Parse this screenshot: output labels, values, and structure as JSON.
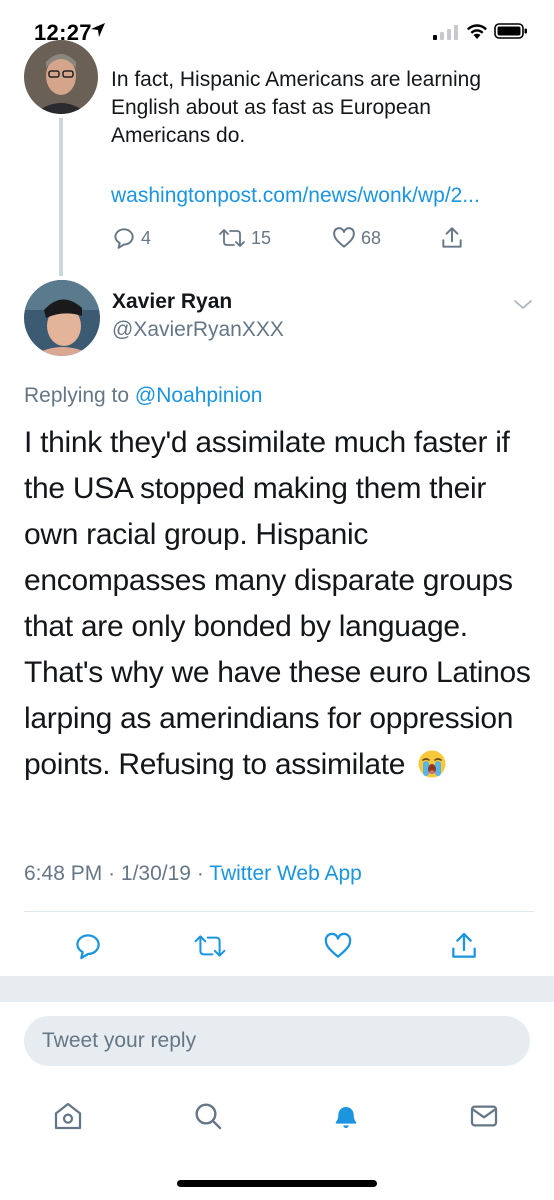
{
  "status_bar": {
    "time": "12:27",
    "icons": [
      "location-arrow-icon",
      "cellular-signal-icon",
      "wifi-icon",
      "battery-icon"
    ]
  },
  "previous_tweet": {
    "text": "In fact, Hispanic Americans are learning English about as fast as European Americans do.",
    "link": "washingtonpost.com/news/wonk/wp/2...",
    "reply_count": "4",
    "retweet_count": "15",
    "like_count": "68"
  },
  "tweet": {
    "author_name": "Xavier Ryan",
    "author_handle": "@XavierRyanXXX",
    "replying_to_label": "Replying to",
    "replying_to_handle": "@Noahpinion",
    "body": "I think they'd assimilate much faster if the USA stopped making them their own racial group. Hispanic encompasses many disparate groups that are only bonded by language. That's why we have these euro Latinos larping as amerindians for oppression points. Refusing to assimilate",
    "emoji": "loudly-crying-face-emoji",
    "time": "6:48 PM",
    "date": "1/30/19",
    "separator": "·",
    "source": "Twitter Web App"
  },
  "reply_input": {
    "placeholder": "Tweet your reply",
    "value": ""
  },
  "tab_bar": {
    "items": [
      "home-icon",
      "search-icon",
      "notifications-icon",
      "messages-icon"
    ],
    "active": "notifications-icon"
  },
  "colors": {
    "link_blue": "#1b95e0",
    "secondary_text": "#657786",
    "primary_text": "#14171a",
    "band_gray": "#e6ecf0"
  }
}
